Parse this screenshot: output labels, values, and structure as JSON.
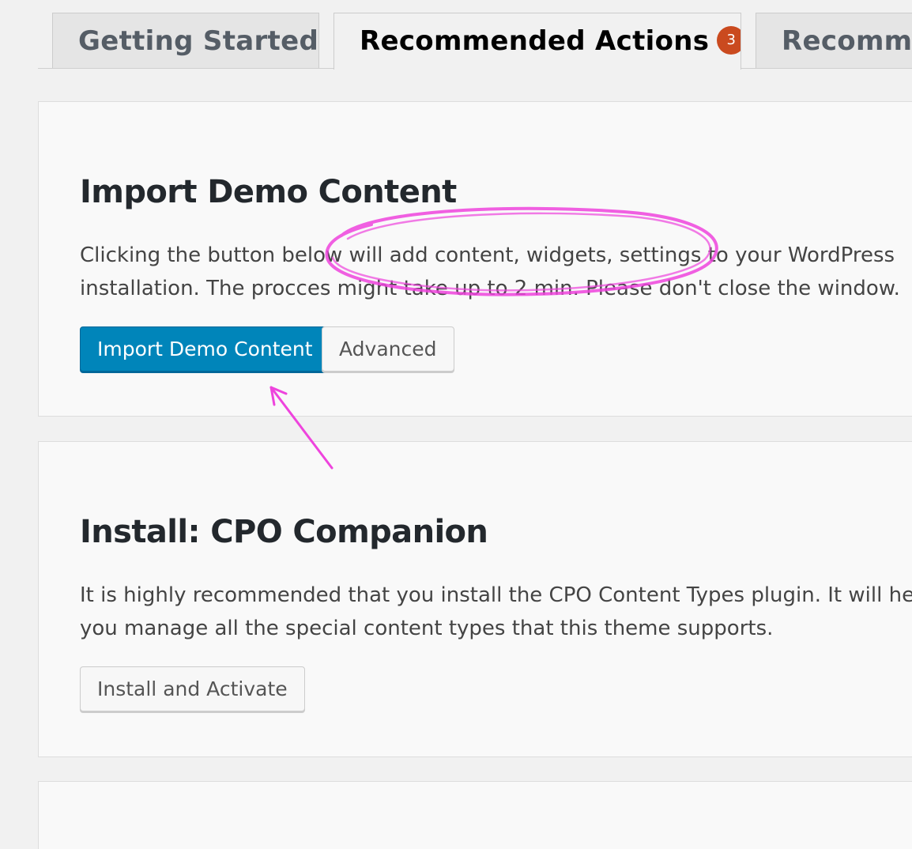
{
  "tabs": [
    {
      "label": "Getting Started",
      "active": false
    },
    {
      "label": "Recommended Actions",
      "active": true,
      "badge": "3"
    },
    {
      "label": "Recommended Plugins",
      "active": false
    }
  ],
  "cards": {
    "import_demo": {
      "title": "Import Demo Content",
      "description": "Clicking the button below will add content, widgets, settings to your WordPress installation. The procces might take up to 2 min. Please don't close the window.",
      "primary_button": "Import Demo Content",
      "secondary_button": "Advanced"
    },
    "install_cpo": {
      "title": "Install: CPO Companion",
      "description": "It is highly recommended that you install the CPO Content Types plugin. It will help you manage all the special content types that this theme supports.",
      "button": "Install and Activate"
    }
  },
  "annotation": {
    "color": "#ee44dd"
  },
  "colors": {
    "accent": "#0085ba",
    "badge": "#ca4a1f",
    "background": "#f1f1f1",
    "card": "#f9f9f9"
  }
}
